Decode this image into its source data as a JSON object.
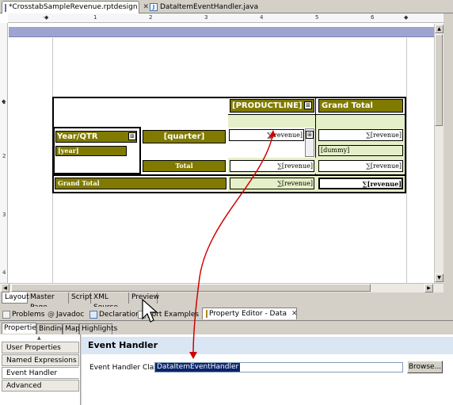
{
  "editor_tabs": [
    {
      "label": "*CrosstabSampleRevenue.rptdesign",
      "active": true
    },
    {
      "label": "DataItemEventHandler.java",
      "active": false
    }
  ],
  "ruler": {
    "h_numbers": [
      "1",
      "2",
      "3",
      "4",
      "5",
      "6"
    ],
    "v_numbers": [
      "1",
      "2",
      "3",
      "4"
    ]
  },
  "crosstab": {
    "productline": "[PRODUCTLINE]",
    "grand_total_header": "Grand Total",
    "year_qtr": "Year/QTR",
    "year": "[year]",
    "quarter": "[quarter]",
    "total": "Total",
    "grand_total_row": "Grand Total",
    "revenue": "[revenue]",
    "revenue_sigma": "∑",
    "dummy": "[dummy]",
    "menu_glyph": "⊞"
  },
  "layout_tabs": [
    "Layout",
    "Master Page",
    "Script",
    "XML Source",
    "Preview"
  ],
  "view_tabs": [
    {
      "label": "Problems",
      "icon": "problems-icon"
    },
    {
      "label": "Javadoc",
      "icon": "javadoc-icon"
    },
    {
      "label": "Declaration",
      "icon": "declaration-icon"
    },
    {
      "label": "Report Examples",
      "icon": "report-examples-icon"
    },
    {
      "label": "Property Editor - Data",
      "icon": "property-editor-icon",
      "active": true
    }
  ],
  "report_examples_visible": "port Examples",
  "property_tabs": [
    "Properties",
    "Binding",
    "Map",
    "Highlights"
  ],
  "side_items": [
    "User Properties",
    "Named Expressions",
    "Event Handler",
    "Advanced"
  ],
  "panel": {
    "title": "Event Handler",
    "class_label": "Event Handler Class:",
    "class_value": "DataItemEventHandler",
    "browse_label": "Browse..."
  },
  "colors": {
    "olive": "#807a00",
    "light_green": "#e6f0c8",
    "arrow": "#d10000",
    "selection": "#0a246a"
  }
}
